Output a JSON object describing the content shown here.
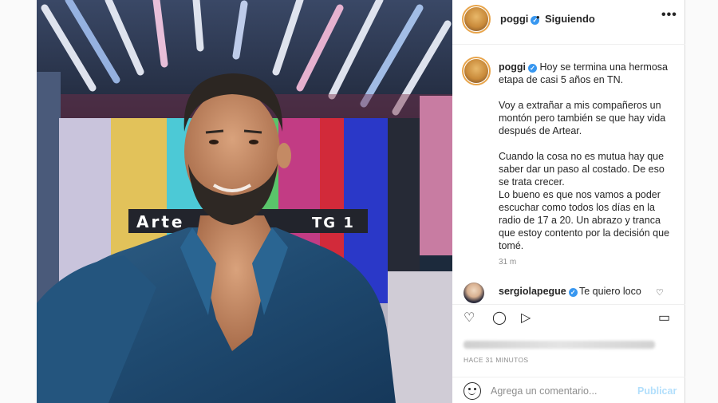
{
  "header": {
    "username": "poggi",
    "verified_mark": "✓",
    "separator": "•",
    "follow_status": "Siguiendo",
    "more_icon": "•••"
  },
  "caption": {
    "username": "poggi",
    "text": "Hoy se termina una hermosa etapa de casi 5 años en TN.\n\nVoy a extrañar a mis compañeros un montón pero también se que hay vida después de Artear.\n\nCuando la cosa no es mutua hay que saber dar un paso al costado. De eso se trata crecer.\nLo bueno es que nos vamos a poder escuchar como todos los días en la radio de 17 a 20. Un abrazo y tranca que estoy contento por la decisión que tomé.",
    "time": "31 m"
  },
  "comment": {
    "username": "sergiolapegue",
    "text": "Te quiero loco",
    "heart_icon": "♡"
  },
  "photo": {
    "sign_text_left": "Arte",
    "sign_text_right": "TG 1"
  },
  "timestamp": "HACE 31 MINUTOS",
  "add_comment": {
    "placeholder": "Agrega un comentario...",
    "publish_label": "Publicar"
  },
  "colors": {
    "verified": "#3897f0",
    "publish_disabled": "#b2dffc",
    "muted_text": "#8e8e8e"
  }
}
